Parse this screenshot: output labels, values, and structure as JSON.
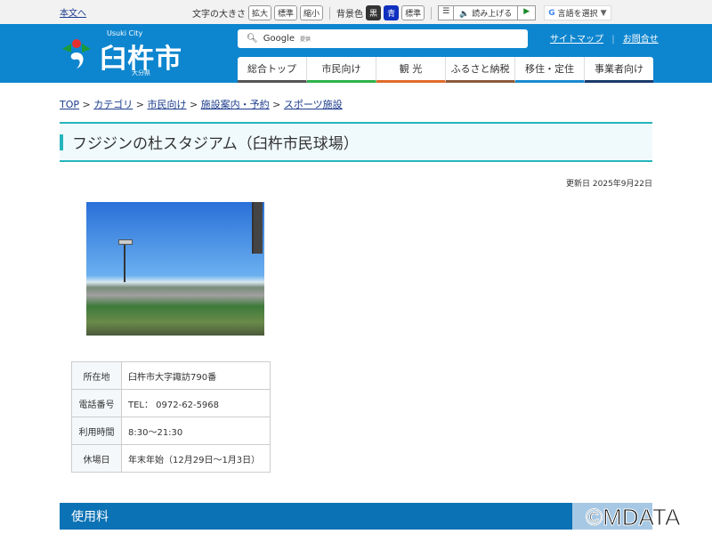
{
  "topbar": {
    "skip_link": "本文へ",
    "font_size_label": "文字の大きさ",
    "font_large": "拡大",
    "font_normal": "標準",
    "font_small": "縮小",
    "bg_label": "背景色",
    "bg_black": "黒",
    "bg_blue": "青",
    "bg_normal": "標準",
    "read_aloud": "読み上げる",
    "language": "言語を選択"
  },
  "header": {
    "city_en": "Usuki City",
    "city_ja": "臼杵市",
    "prefecture": "大分県",
    "search_brand": "Google",
    "search_sub": "提供",
    "sitemap": "サイトマップ",
    "contact": "お問合せ"
  },
  "nav": [
    {
      "label": "総合トップ",
      "color": "#555555"
    },
    {
      "label": "市民向け",
      "color": "#2db24a"
    },
    {
      "label": "観 光",
      "color": "#e06a2a"
    },
    {
      "label": "ふるさと納税",
      "color": "#8a5a3a"
    },
    {
      "label": "移住・定住",
      "color": "#1a8ad0"
    },
    {
      "label": "事業者向け",
      "color": "#1a3a6a"
    }
  ],
  "breadcrumb": [
    "TOP",
    "カテゴリ",
    "市民向け",
    "施設案内・予約",
    "スポーツ施設"
  ],
  "page_title": "フジジンの杜スタジアム（臼杵市民球場）",
  "updated": "更新日 2025年9月22日",
  "info": [
    {
      "label": "所在地",
      "value": "臼杵市大字諏訪790番"
    },
    {
      "label": "電話番号",
      "value": "TEL： 0972-62-5968"
    },
    {
      "label": "利用時間",
      "value": "8:30～21:30"
    },
    {
      "label": "休場日",
      "value": "年末年始（12月29日～1月3日）"
    }
  ],
  "section_heading": "使用料",
  "watermark": "©MDATA"
}
